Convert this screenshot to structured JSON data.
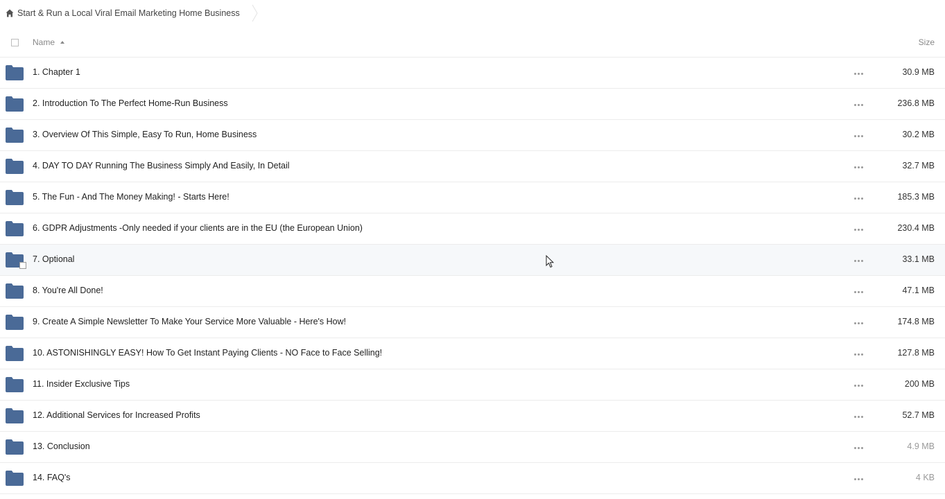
{
  "breadcrumb": {
    "home_icon": "home-icon",
    "title": "Start & Run a Local Viral Email Marketing Home Business"
  },
  "header": {
    "name_label": "Name",
    "size_label": "Size",
    "sort": "ascending"
  },
  "colors": {
    "folder": "#4a6a97",
    "text": "#222222",
    "muted": "#9a9a9a",
    "divider": "#ececec",
    "hover_row": "#f6f8fa"
  },
  "rows": [
    {
      "name": "1. Chapter 1",
      "size": "30.9 MB"
    },
    {
      "name": "2. Introduction To The Perfect Home-Run Business",
      "size": "236.8 MB"
    },
    {
      "name": "3. Overview Of This Simple, Easy To Run, Home Business",
      "size": "30.2 MB"
    },
    {
      "name": "4. DAY TO DAY Running The Business Simply And Easily, In Detail",
      "size": "32.7 MB"
    },
    {
      "name": "5. The Fun - And The Money Making! - Starts Here!",
      "size": "185.3 MB"
    },
    {
      "name": "6. GDPR Adjustments -Only needed if your clients are in the EU (the European Union)",
      "size": "230.4 MB"
    },
    {
      "name": "7. Optional",
      "size": "33.1 MB"
    },
    {
      "name": "8. You're All Done!",
      "size": "47.1 MB"
    },
    {
      "name": "9. Create A Simple Newsletter To Make Your Service More Valuable - Here's How!",
      "size": "174.8 MB"
    },
    {
      "name": "10. ASTONISHINGLY EASY! How To Get Instant Paying Clients - NO Face to Face Selling!",
      "size": "127.8 MB"
    },
    {
      "name": "11. Insider Exclusive Tips",
      "size": "200 MB"
    },
    {
      "name": "12. Additional Services for Increased Profits",
      "size": "52.7 MB"
    },
    {
      "name": "13. Conclusion",
      "size": "4.9 MB"
    },
    {
      "name": "14. FAQ's",
      "size": "4 KB"
    }
  ]
}
